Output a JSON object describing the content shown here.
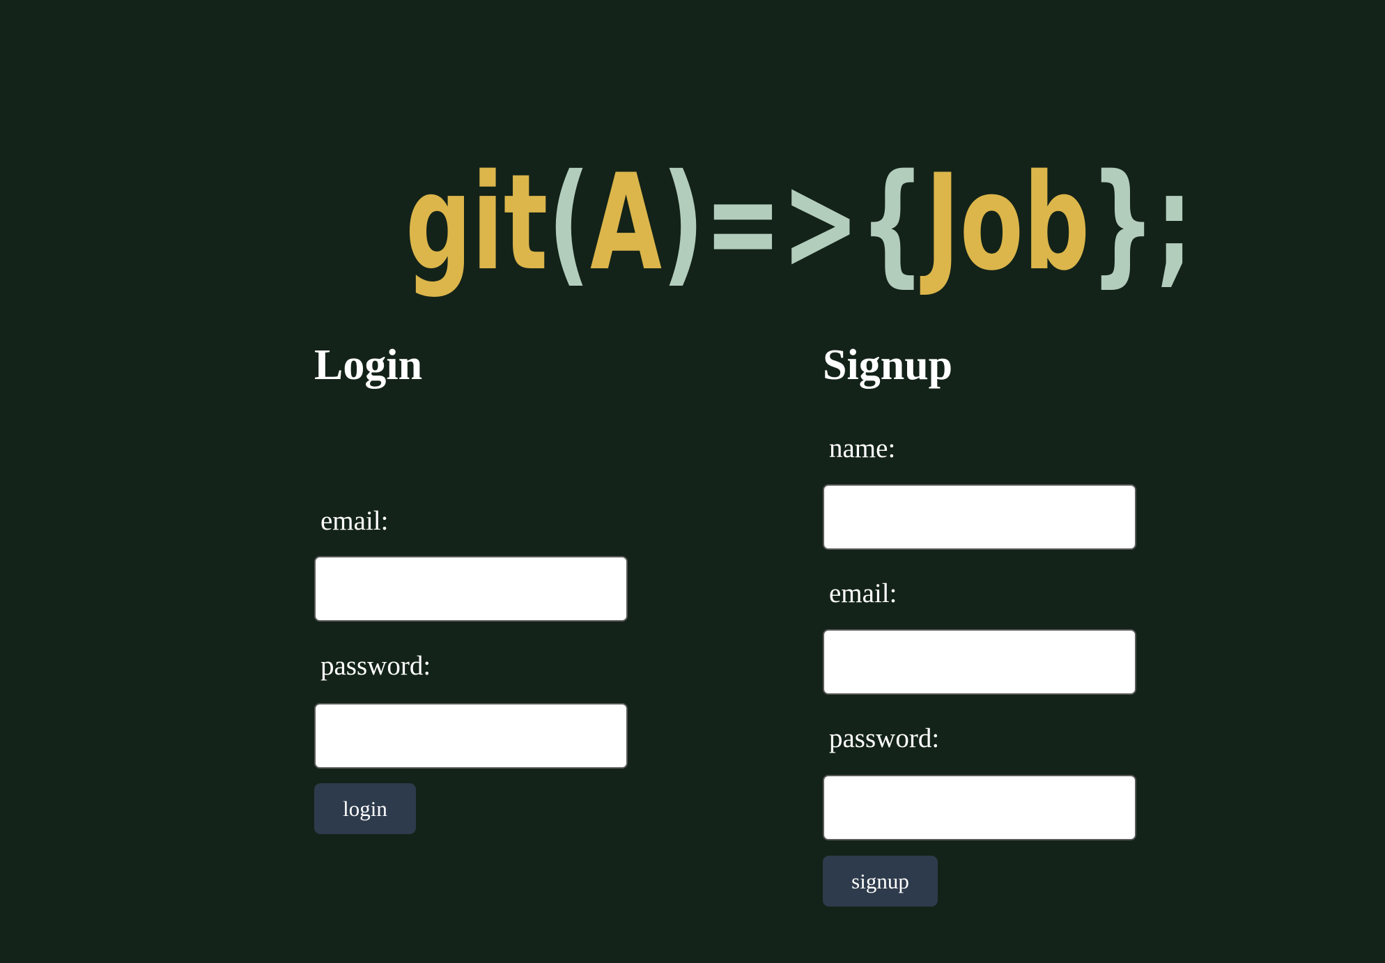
{
  "colors": {
    "background": "#142319",
    "logo_gold": "#dcb64b",
    "logo_sage": "#b3cdbd",
    "button_bg": "#2e3b4c",
    "text": "#ffffff"
  },
  "logo": {
    "text": "git(A)=>{Job};",
    "part_git": "git",
    "part_open_paren": "(",
    "part_a": "A",
    "part_close_paren": ")",
    "part_arrow": "=>",
    "part_open_brace": "{",
    "part_job": "Job",
    "part_close_brace": "}",
    "part_semicolon": ";"
  },
  "login": {
    "title": "Login",
    "email_label": "email:",
    "email_value": "",
    "password_label": "password:",
    "password_value": "",
    "submit_label": "login"
  },
  "signup": {
    "title": "Signup",
    "name_label": "name:",
    "name_value": "",
    "email_label": "email:",
    "email_value": "",
    "password_label": "password:",
    "password_value": "",
    "submit_label": "signup"
  }
}
